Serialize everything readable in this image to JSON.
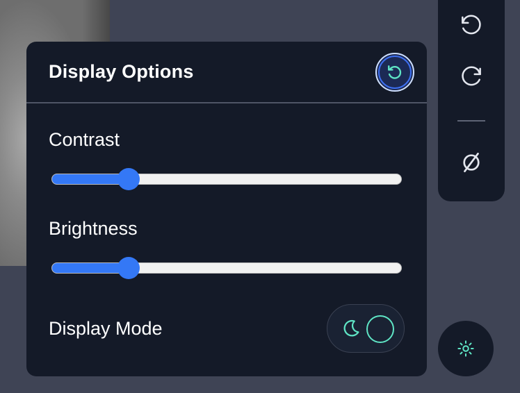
{
  "panel": {
    "title": "Display Options",
    "reset_icon": "reset-icon",
    "contrast": {
      "label": "Contrast",
      "value": 0.22
    },
    "brightness": {
      "label": "Brightness",
      "value": 0.22
    },
    "display_mode": {
      "label": "Display Mode",
      "icon": "moon-icon",
      "state": "dark"
    }
  },
  "toolbar": {
    "items": [
      {
        "icon": "undo-icon"
      },
      {
        "icon": "redo-icon"
      },
      {
        "icon": "no-symbol-icon"
      }
    ]
  },
  "fab": {
    "icon": "settings-icon"
  },
  "colors": {
    "panel_bg": "#141a28",
    "accent_blue": "#3478f6",
    "accent_teal": "#5fe5c5",
    "page_bg": "#3f4455"
  }
}
